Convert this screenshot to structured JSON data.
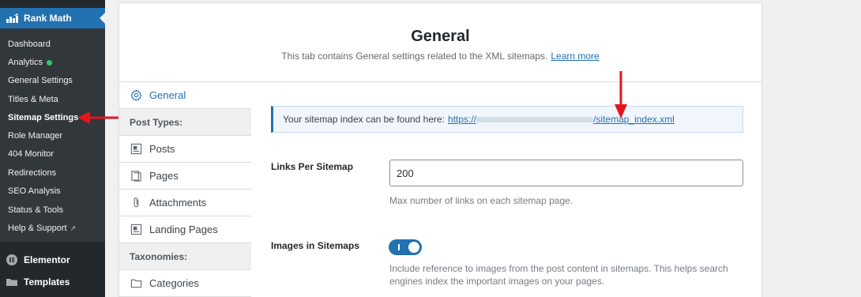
{
  "sidebar": {
    "brand": "Rank Math",
    "items": [
      {
        "label": "Dashboard"
      },
      {
        "label": "Analytics"
      },
      {
        "label": "General Settings"
      },
      {
        "label": "Titles & Meta"
      },
      {
        "label": "Sitemap Settings"
      },
      {
        "label": "Role Manager"
      },
      {
        "label": "404 Monitor"
      },
      {
        "label": "Redirections"
      },
      {
        "label": "SEO Analysis"
      },
      {
        "label": "Status & Tools"
      },
      {
        "label": "Help & Support"
      }
    ],
    "menu": [
      {
        "label": "Elementor"
      },
      {
        "label": "Templates"
      }
    ]
  },
  "panel": {
    "title": "General",
    "description": "This tab contains General settings related to the XML sitemaps.",
    "learn_more": "Learn more"
  },
  "tabs": {
    "general": "General",
    "post_types_header": "Post Types:",
    "posts": "Posts",
    "pages": "Pages",
    "attachments": "Attachments",
    "landing_pages": "Landing Pages",
    "taxonomies_header": "Taxonomies:",
    "categories": "Categories"
  },
  "notice": {
    "text": "Your sitemap index can be found here:",
    "url_prefix": "https://",
    "url_suffix": "/sitemap_index.xml"
  },
  "fields": {
    "links_per_sitemap": {
      "label": "Links Per Sitemap",
      "value": "200",
      "help": "Max number of links on each sitemap page."
    },
    "images_in_sitemaps": {
      "label": "Images in Sitemaps",
      "enabled": true,
      "help_line1": "Include reference to images from the post content in sitemaps. This helps search",
      "help_line2": "engines index the important images on your pages."
    }
  },
  "colors": {
    "accent": "#2271b1",
    "sidebar_bg": "#23282d",
    "annotation_arrow": "#e4141b",
    "analytics_dot": "#2ecc71"
  }
}
